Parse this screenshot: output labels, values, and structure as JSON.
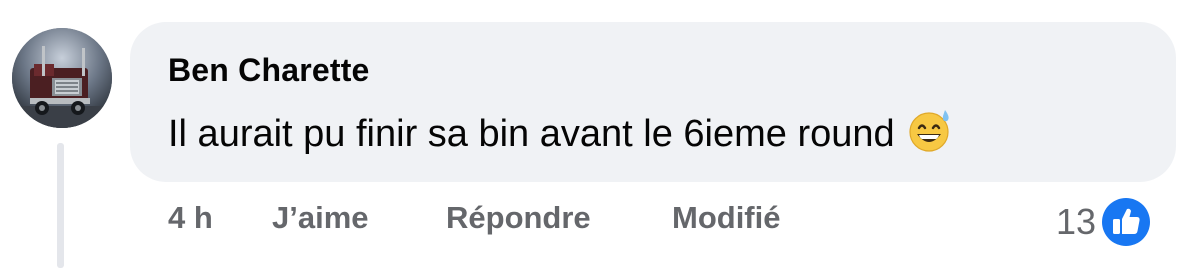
{
  "comment": {
    "author": "Ben Charette",
    "text": "Il aurait pu finir sa bin avant le 6ieme round",
    "emoji": "grinning-face-with-sweat-icon"
  },
  "actions": {
    "time": "4 h",
    "like_label": "J’aime",
    "reply_label": "Répondre",
    "edited_label": "Modifié"
  },
  "reactions": {
    "count": "13",
    "type": "like-icon"
  },
  "colors": {
    "bubble": "#f0f2f5",
    "text": "#050505",
    "secondary": "#65676b",
    "like_blue": "#1877f2"
  }
}
